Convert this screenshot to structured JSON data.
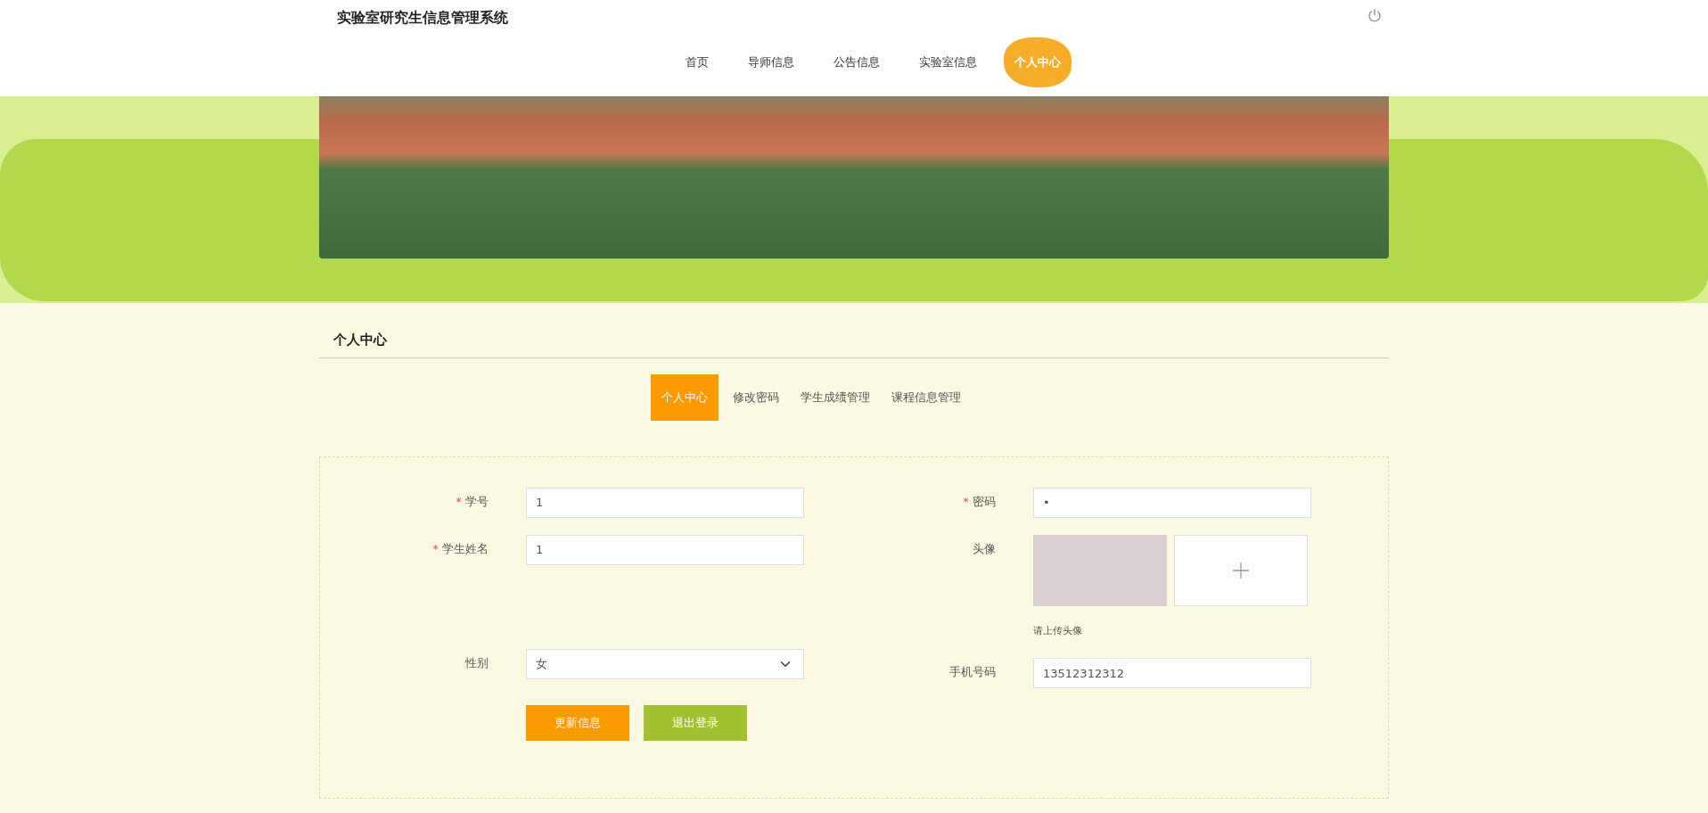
{
  "header": {
    "title": "实验室研究生信息管理系统"
  },
  "nav": [
    {
      "label": "首页",
      "selected": false
    },
    {
      "label": "导师信息",
      "selected": false
    },
    {
      "label": "公告信息",
      "selected": false
    },
    {
      "label": "实验室信息",
      "selected": false
    },
    {
      "label": "个人中心",
      "selected": true
    }
  ],
  "section": {
    "title": "个人中心"
  },
  "tabs": [
    {
      "label": "个人中心",
      "selected": true
    },
    {
      "label": "修改密码",
      "selected": false
    },
    {
      "label": "学生成绩管理",
      "selected": false
    },
    {
      "label": "课程信息管理",
      "selected": false
    }
  ],
  "form": {
    "left": [
      {
        "kind": "text",
        "mark": "*",
        "label": "学号",
        "value": "1"
      },
      {
        "kind": "text",
        "mark": "*",
        "label": "学生姓名",
        "value": "1"
      },
      {
        "kind": "select",
        "label": "性别",
        "value": "女"
      }
    ],
    "right": [
      {
        "kind": "text",
        "mark": "*",
        "label": "密码",
        "value": "•"
      },
      {
        "kind": "avatar",
        "label": "头像",
        "hint": "请上传头像"
      },
      {
        "kind": "text",
        "label": "手机号码",
        "value": "13512312312"
      }
    ],
    "buttons": [
      {
        "label": "更新信息",
        "kind": "primary"
      },
      {
        "label": "退出登录",
        "kind": "secondary"
      }
    ]
  }
}
